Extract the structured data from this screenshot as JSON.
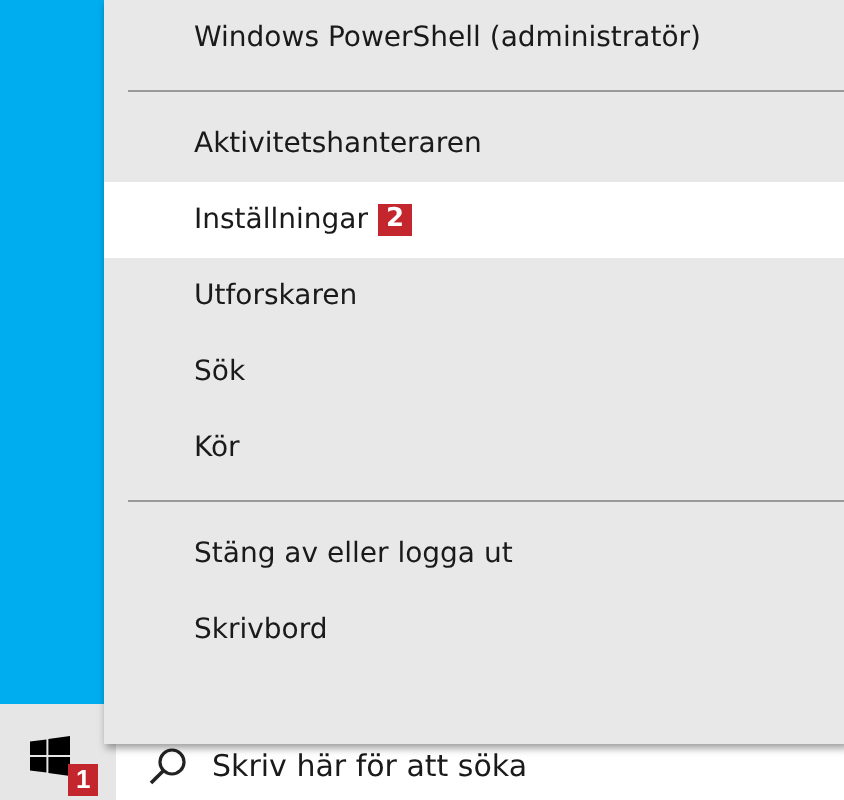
{
  "menu": {
    "groups": [
      [
        {
          "label": "Windows PowerShell (administratör)",
          "selected": false
        }
      ],
      [
        {
          "label": "Aktivitetshanteraren",
          "selected": false
        },
        {
          "label": "Inställningar",
          "selected": true,
          "badge": "2"
        },
        {
          "label": "Utforskaren",
          "selected": false
        },
        {
          "label": "Sök",
          "selected": false
        },
        {
          "label": "Kör",
          "selected": false
        }
      ],
      [
        {
          "label": "Stäng av eller logga ut",
          "selected": false
        },
        {
          "label": "Skrivbord",
          "selected": false
        }
      ]
    ]
  },
  "taskbar": {
    "start_badge": "1",
    "search": {
      "placeholder": "Skriv här för att söka"
    }
  }
}
